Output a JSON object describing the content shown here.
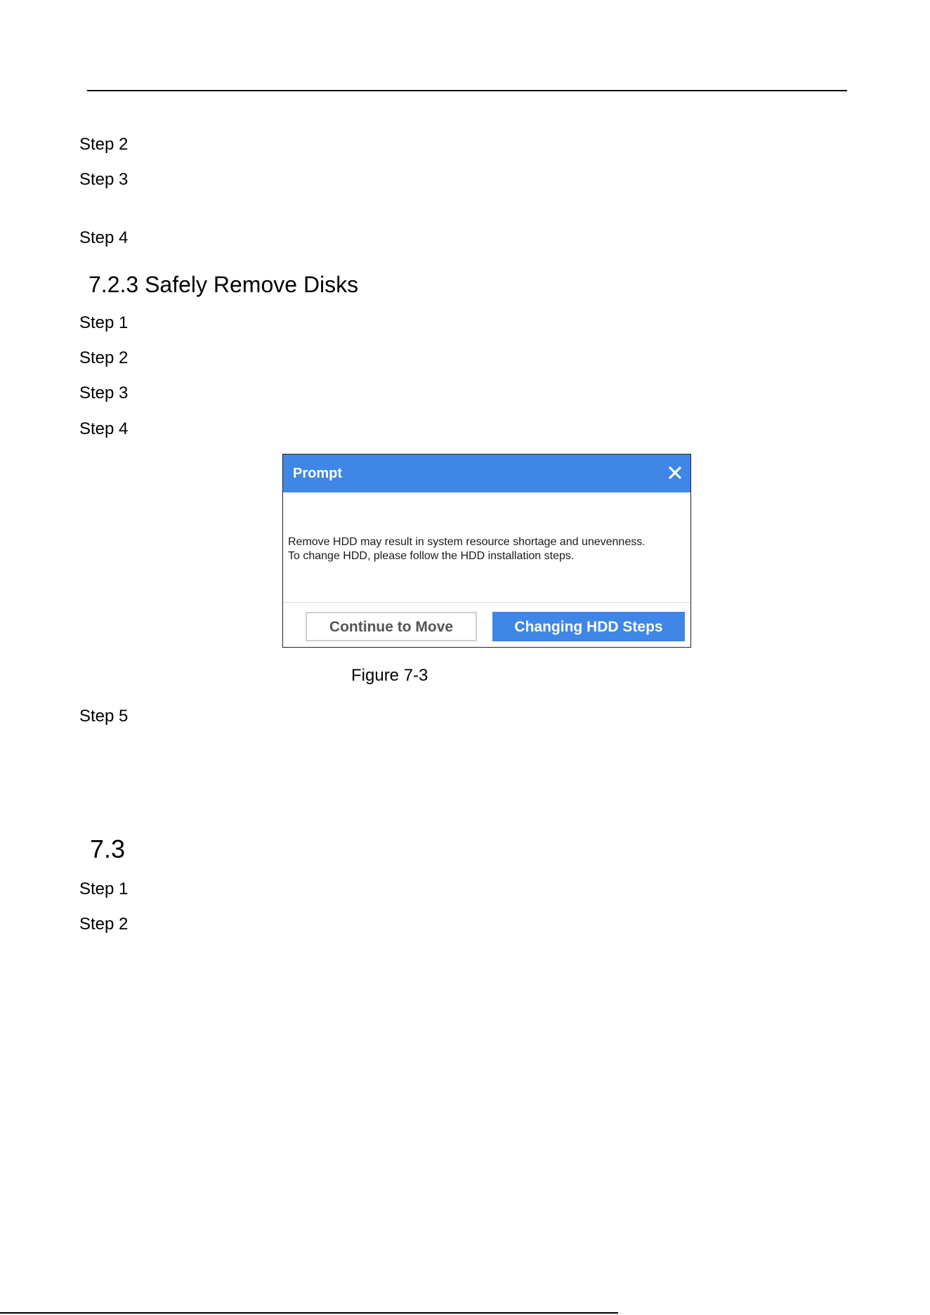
{
  "steps_section_1": [
    "Step 2",
    "Step 3",
    "Step 4"
  ],
  "section_723": {
    "heading": "7.2.3 Safely Remove Disks",
    "steps": [
      "Step 1",
      "Step 2",
      "Step 3",
      "Step 4"
    ]
  },
  "dialog": {
    "title": "Prompt",
    "close_icon": "close-icon",
    "message_line1": "Remove HDD may result in system resource shortage and unevenness.",
    "message_line2": "To change HDD, please follow the HDD installation steps.",
    "secondary_button": "Continue to Move",
    "primary_button": "Changing HDD Steps",
    "colors": {
      "header": "#3f86e6",
      "primary_button": "#3f86e6"
    }
  },
  "figure_caption": "Figure 7-3",
  "step_after_figure": "Step 5",
  "section_73": {
    "heading": "7.3",
    "steps": [
      "Step 1",
      "Step 2"
    ]
  }
}
